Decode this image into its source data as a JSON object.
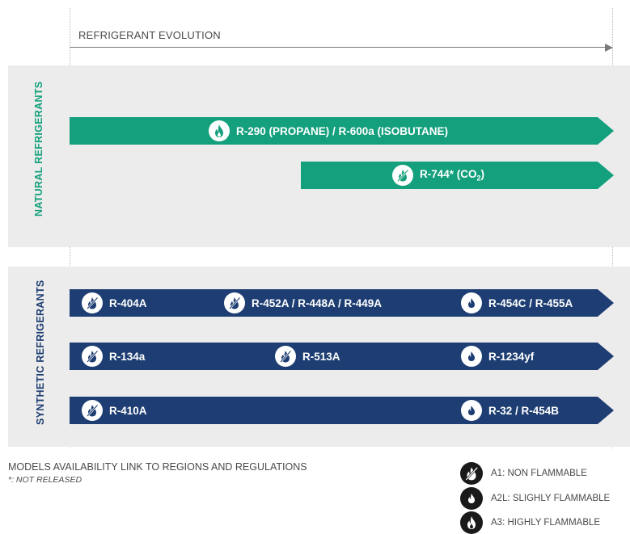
{
  "axis": {
    "label": "REFRIGERANT EVOLUTION"
  },
  "natural": {
    "title": "NATURAL REFRIGERANTS",
    "rows": [
      {
        "items": [
          {
            "label": "R-290 (PROPANE) / R-600a (ISOBUTANE)",
            "flammability": "A3"
          }
        ]
      },
      {
        "items": [
          {
            "label": "R-744* (CO",
            "sub": "2",
            "suffix": ")",
            "flammability": "A1"
          }
        ]
      }
    ]
  },
  "synthetic": {
    "title": "SYNTHETIC REFRIGERANTS",
    "rows": [
      {
        "items": [
          {
            "label": "R-404A",
            "flammability": "A1"
          },
          {
            "label": "R-452A / R-448A / R-449A",
            "flammability": "A1"
          },
          {
            "label": "R-454C / R-455A",
            "flammability": "A2L"
          }
        ]
      },
      {
        "items": [
          {
            "label": "R-134a",
            "flammability": "A1"
          },
          {
            "label": "R-513A",
            "flammability": "A1"
          },
          {
            "label": "R-1234yf",
            "flammability": "A2L"
          }
        ]
      },
      {
        "items": [
          {
            "label": "R-410A",
            "flammability": "A1"
          },
          {
            "label": "R-32 / R-454B",
            "flammability": "A2L"
          }
        ]
      }
    ]
  },
  "notes": {
    "line1": "MODELS AVAILABILITY LINK TO REGIONS AND REGULATIONS",
    "line2": "*: NOT RELEASED"
  },
  "legend": [
    {
      "code": "A1",
      "text": "A1: NON FLAMMABLE",
      "icon": "non-flammable-icon"
    },
    {
      "code": "A2L",
      "text": "A2L: SLIGHLY FLAMMABLE",
      "icon": "slightly-flammable-icon"
    },
    {
      "code": "A3",
      "text": "A3: HIGHLY FLAMMABLE",
      "icon": "highly-flammable-icon"
    }
  ],
  "colors": {
    "natural": "#14a07c",
    "synthetic": "#1e3e73",
    "panel": "#ececec"
  }
}
